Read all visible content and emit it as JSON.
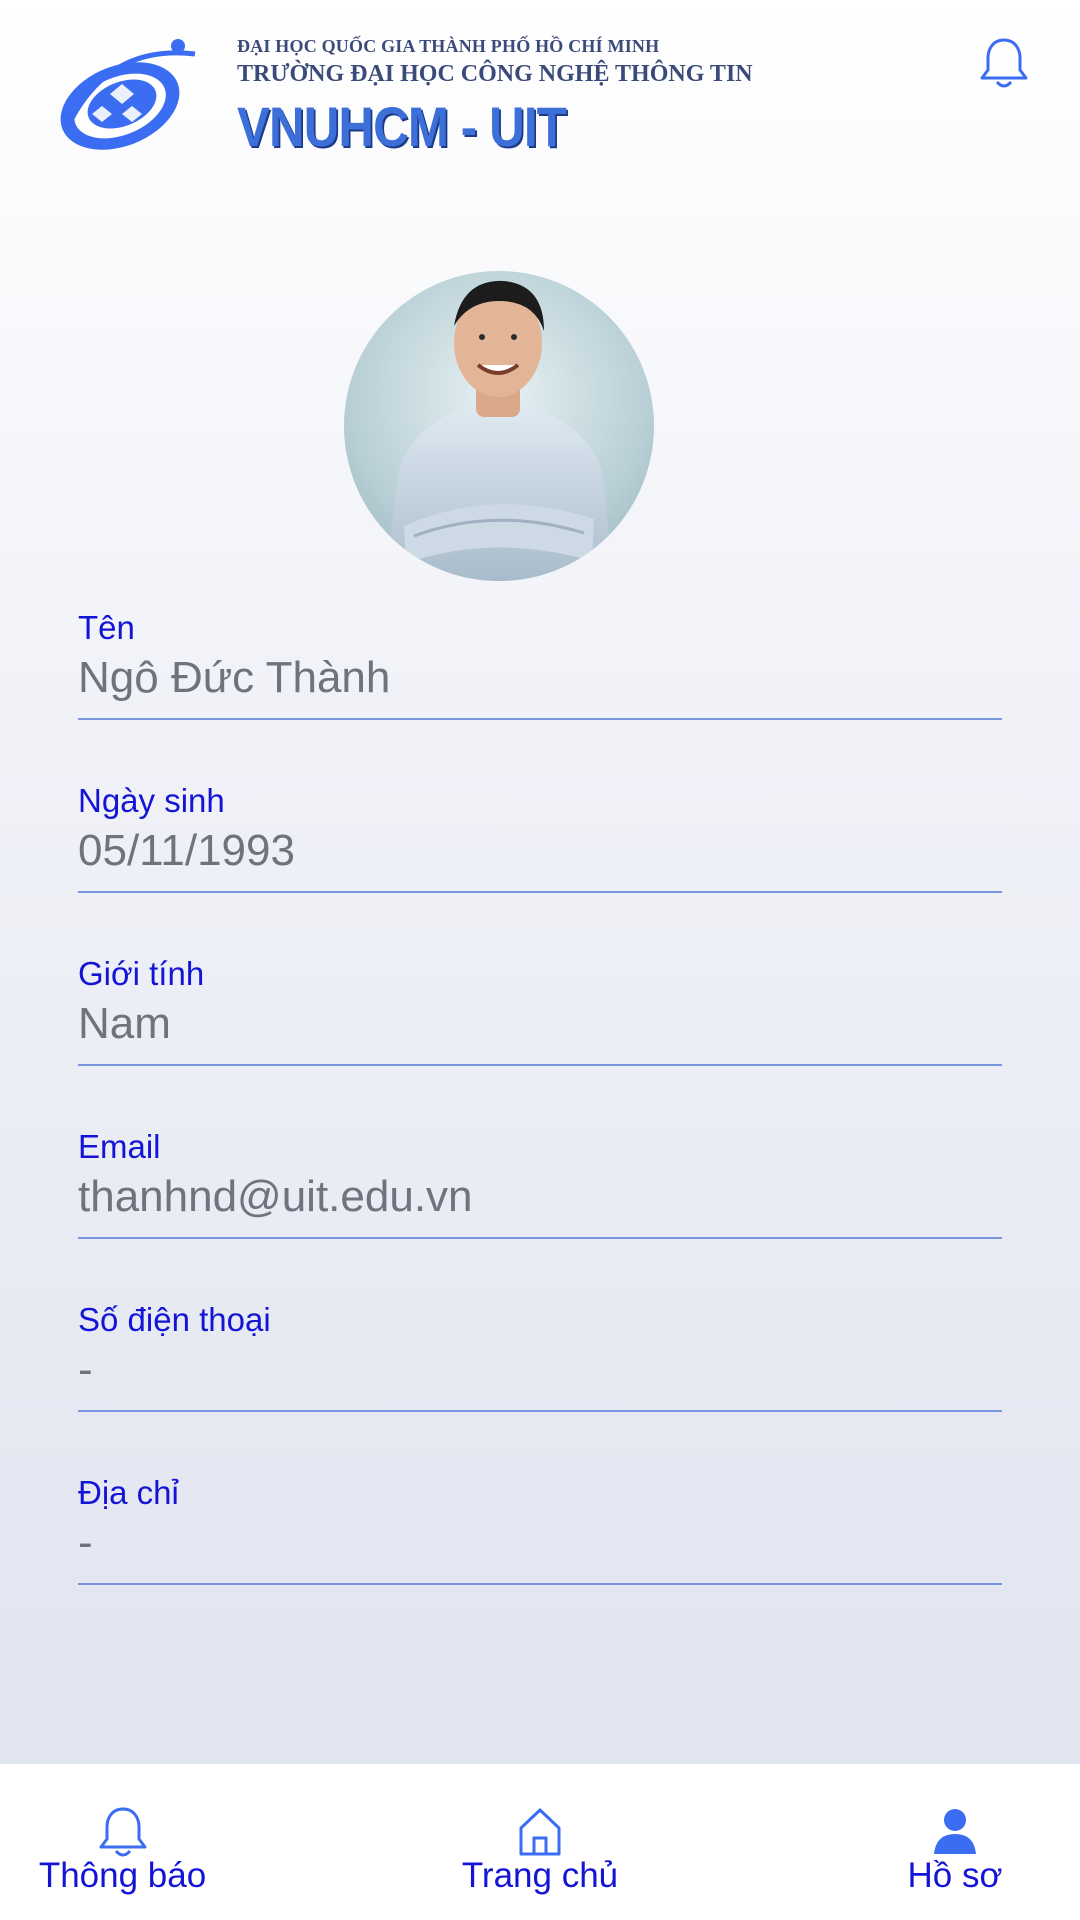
{
  "header": {
    "line1": "ĐẠI HỌC QUỐC GIA THÀNH PHỐ HỒ CHÍ MINH",
    "line2": "TRƯỜNG ĐẠI HỌC CÔNG NGHỆ THÔNG TIN",
    "line3": "VNUHCM - UIT",
    "bell_icon": "bell-icon"
  },
  "profile": {
    "avatar_alt": "profile photo",
    "fields": [
      {
        "label": "Tên",
        "value": "Ngô Đức Thành"
      },
      {
        "label": "Ngày sinh",
        "value": "05/11/1993"
      },
      {
        "label": "Giới tính",
        "value": "Nam"
      },
      {
        "label": "Email",
        "value": "thanhnd@uit.edu.vn"
      },
      {
        "label": "Số điện thoại",
        "value": "-"
      },
      {
        "label": "Địa chỉ",
        "value": "-"
      }
    ]
  },
  "nav": {
    "items": [
      {
        "label": "Thông báo",
        "icon": "bell-icon"
      },
      {
        "label": "Trang chủ",
        "icon": "home-icon"
      },
      {
        "label": "Hồ sơ",
        "icon": "profile-icon"
      }
    ],
    "accent": "#1414d6",
    "icon_color": "#3b6df2"
  }
}
